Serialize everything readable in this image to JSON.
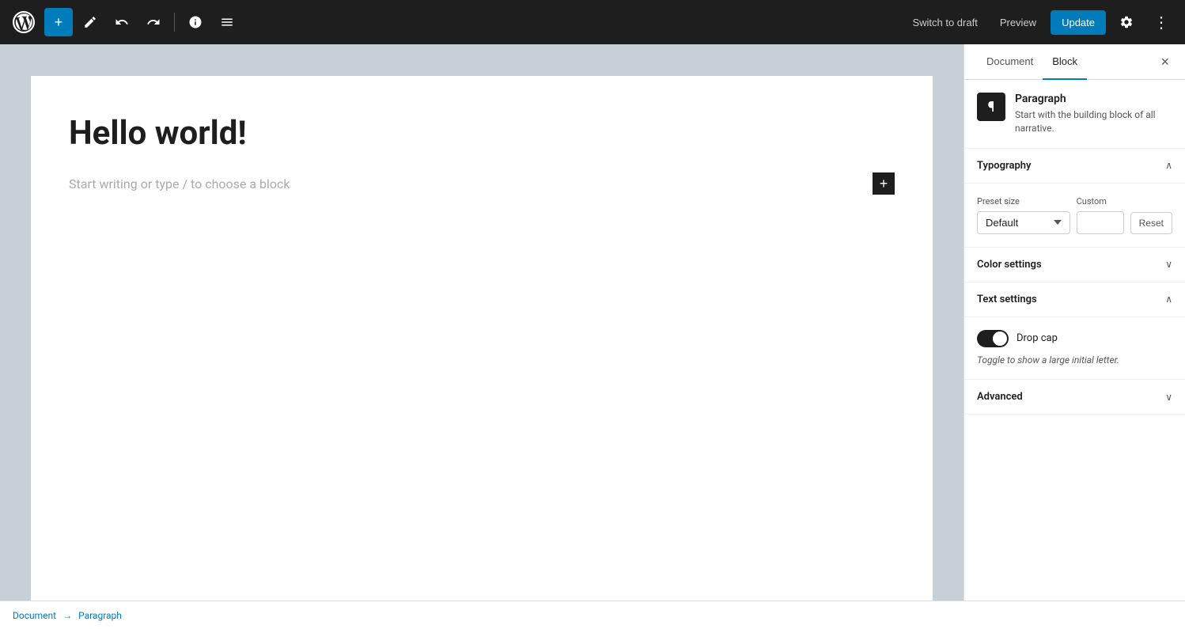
{
  "toolbar": {
    "add_label": "+",
    "switch_draft_label": "Switch to draft",
    "preview_label": "Preview",
    "update_label": "Update"
  },
  "editor": {
    "post_title": "Hello world!",
    "block_placeholder": "Start writing or type / to choose a block"
  },
  "sidebar": {
    "tab_document": "Document",
    "tab_block": "Block",
    "close_label": "×",
    "block_icon": "¶",
    "block_name": "Paragraph",
    "block_description": "Start with the building block of all narrative.",
    "typography_label": "Typography",
    "preset_size_label": "Preset size",
    "custom_label": "Custom",
    "preset_default": "Default",
    "reset_label": "Reset",
    "color_settings_label": "Color settings",
    "text_settings_label": "Text settings",
    "drop_cap_label": "Drop cap",
    "drop_cap_description": "Toggle to show a large initial letter.",
    "advanced_label": "Advanced"
  },
  "status_bar": {
    "document_label": "Document",
    "arrow": "→",
    "paragraph_label": "Paragraph"
  }
}
